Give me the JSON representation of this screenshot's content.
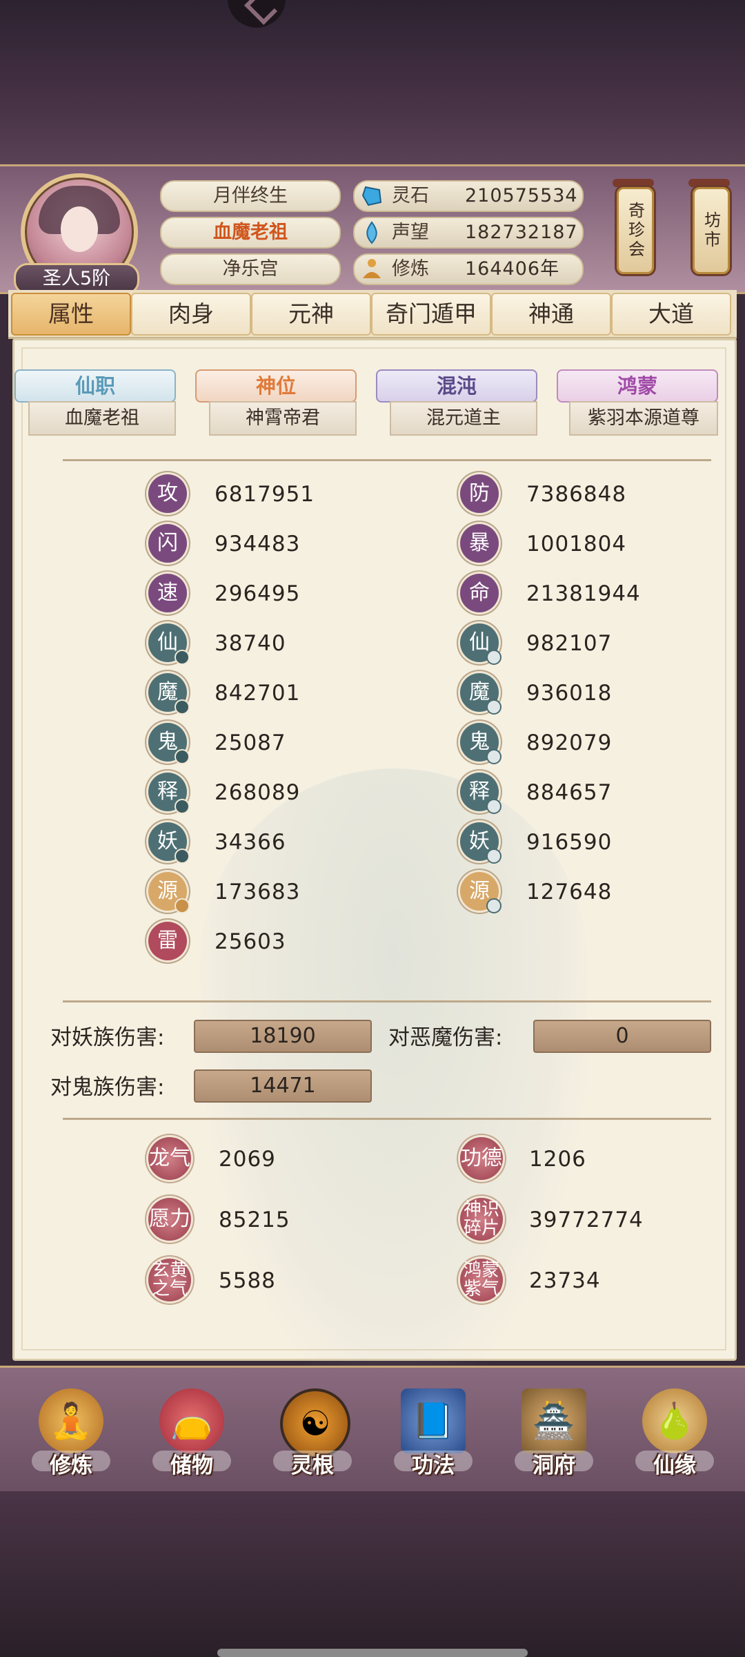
{
  "header": {
    "rank_label": "圣人5阶",
    "names": [
      "月伴终生",
      "血魔老祖",
      "净乐宫"
    ],
    "resources": [
      {
        "icon": "spirit-stone-icon",
        "label": "灵石",
        "value": "210575534"
      },
      {
        "icon": "prestige-icon",
        "label": "声望",
        "value": "182732187"
      },
      {
        "icon": "cultivation-icon",
        "label": "修炼",
        "value": "164406年"
      }
    ],
    "scroll_buttons": [
      "奇珍会",
      "坊市"
    ]
  },
  "tabs": [
    "属性",
    "肉身",
    "元神",
    "奇门遁甲",
    "神通",
    "大道"
  ],
  "active_tab": "属性",
  "titles": [
    {
      "label": "仙职",
      "value": "血魔老祖",
      "color": "#5a9ab8"
    },
    {
      "label": "神位",
      "value": "神霄帝君",
      "color": "#e07a3a"
    },
    {
      "label": "混沌",
      "value": "混元道主",
      "color": "#6a5aa0"
    },
    {
      "label": "鸿蒙",
      "value": "紫羽本源道尊",
      "color": "#a04aa8"
    }
  ],
  "stats": {
    "left": [
      {
        "icon": "攻",
        "value": "6817951"
      },
      {
        "icon": "闪",
        "value": "934483"
      },
      {
        "icon": "速",
        "value": "296495"
      },
      {
        "icon": "仙",
        "value": "38740"
      },
      {
        "icon": "魔",
        "value": "842701"
      },
      {
        "icon": "鬼",
        "value": "25087"
      },
      {
        "icon": "释",
        "value": "268089"
      },
      {
        "icon": "妖",
        "value": "34366"
      },
      {
        "icon": "源",
        "value": "173683"
      },
      {
        "icon": "雷",
        "value": "25603"
      }
    ],
    "right": [
      {
        "icon": "防",
        "value": "7386848"
      },
      {
        "icon": "暴",
        "value": "1001804"
      },
      {
        "icon": "命",
        "value": "21381944"
      },
      {
        "icon": "仙",
        "value": "982107"
      },
      {
        "icon": "魔",
        "value": "936018"
      },
      {
        "icon": "鬼",
        "value": "892079"
      },
      {
        "icon": "释",
        "value": "884657"
      },
      {
        "icon": "妖",
        "value": "916590"
      },
      {
        "icon": "源",
        "value": "127648"
      }
    ]
  },
  "damage": [
    {
      "label": "对妖族伤害:",
      "value": "18190"
    },
    {
      "label": "对恶魔伤害:",
      "value": "0"
    },
    {
      "label": "对鬼族伤害:",
      "value": "14471"
    }
  ],
  "misc": [
    {
      "icon": "龙气",
      "value": "2069"
    },
    {
      "icon": "功德",
      "value": "1206"
    },
    {
      "icon": "愿力",
      "value": "85215"
    },
    {
      "icon": "神识碎片",
      "value": "39772774"
    },
    {
      "icon": "玄黄之气",
      "value": "5588"
    },
    {
      "icon": "鸿蒙紫气",
      "value": "23734"
    }
  ],
  "nav": [
    {
      "label": "修炼",
      "icon": "monk-icon"
    },
    {
      "label": "储物",
      "icon": "bag-icon"
    },
    {
      "label": "灵根",
      "icon": "spirit-root-icon"
    },
    {
      "label": "功法",
      "icon": "book-icon"
    },
    {
      "label": "洞府",
      "icon": "cave-dwelling-icon"
    },
    {
      "label": "仙缘",
      "icon": "gourd-icon"
    }
  ]
}
